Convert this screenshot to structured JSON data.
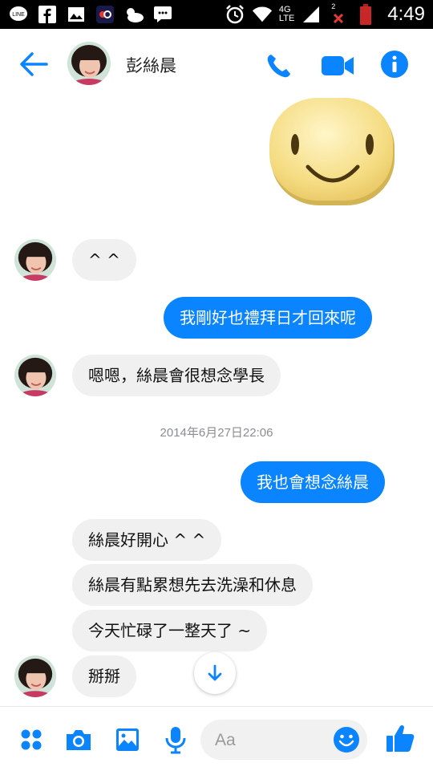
{
  "status_bar": {
    "time": "4:49",
    "network": "4G",
    "network_sub": "LTE",
    "sim_slot": "2",
    "icons": [
      "line-icon",
      "facebook-icon",
      "gallery-icon",
      "app-icon",
      "weather-icon",
      "chat-icon",
      "alarm-icon",
      "wifi-icon",
      "signal-icon",
      "no-signal-icon",
      "battery-icon"
    ]
  },
  "header": {
    "contact_name": "彭絲晨",
    "icons": [
      "back-arrow-icon",
      "phone-icon",
      "video-icon",
      "info-icon"
    ]
  },
  "messages": [
    {
      "from": "them",
      "text": "^ ^"
    },
    {
      "from": "me",
      "text": "我剛好也禮拜日才回來呢"
    },
    {
      "from": "them",
      "text": "嗯嗯，絲晨會很想念學長"
    },
    {
      "from": "me",
      "text": "我也會想念絲晨"
    },
    {
      "from": "them",
      "text": "絲晨好開心 ^ ^"
    },
    {
      "from": "them",
      "text": "絲晨有點累想先去洗澡和休息"
    },
    {
      "from": "them",
      "text": "今天忙碌了一整天了 ~"
    },
    {
      "from": "them",
      "text": "掰掰"
    }
  ],
  "timestamp": "2014年6月27日22:06",
  "composer": {
    "placeholder": "Aa",
    "icons": [
      "menu-dots-icon",
      "camera-icon",
      "image-icon",
      "microphone-icon",
      "emoji-icon",
      "thumbs-up-icon"
    ]
  },
  "colors": {
    "accent": "#0b84ff",
    "incoming_bubble": "#f0f0f0",
    "timestamp_text": "#8a8d91"
  }
}
